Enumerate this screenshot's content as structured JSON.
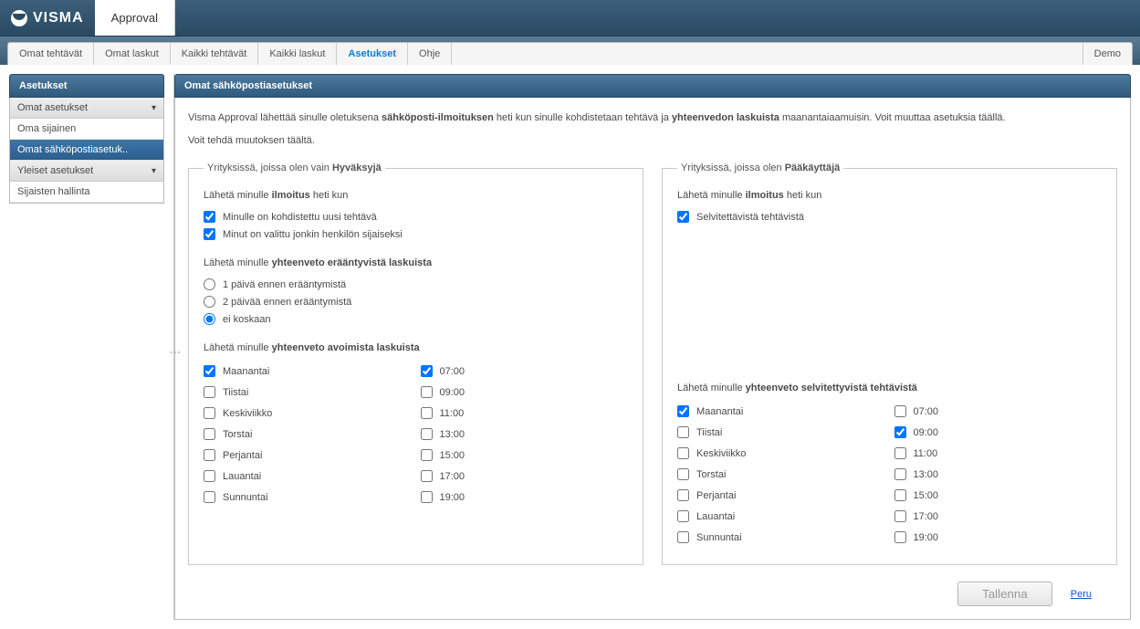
{
  "header": {
    "brand": "VISMA",
    "app_tab": "Approval"
  },
  "subnav": {
    "items": [
      "Omat tehtävät",
      "Omat laskut",
      "Kaikki tehtävät",
      "Kaikki laskut",
      "Asetukset",
      "Ohje"
    ],
    "active_index": 4,
    "right": "Demo"
  },
  "sidebar": {
    "title": "Asetukset",
    "group1": "Omat asetukset",
    "link_substitute": "Oma sijainen",
    "link_email": "Omat sähköpostiasetuk..",
    "group2": "Yleiset asetukset",
    "link_substitutes_mgmt": "Sijaisten hallinta"
  },
  "main": {
    "title": "Omat sähköpostiasetukset",
    "intro_pre": "Visma Approval lähettää sinulle oletuksena ",
    "intro_b1": "sähköposti-ilmoituksen",
    "intro_mid1": " heti kun sinulle kohdistetaan tehtävä ja ",
    "intro_b2": "yhteenvedon laskuista",
    "intro_mid2": " maanantaiaamuisin. Voit muuttaa asetuksia täällä.",
    "intro_line2": "Voit tehdä muutoksen täältä.",
    "panel_left": {
      "legend_pre": "Yrityksissä, joissa olen vain ",
      "legend_b": "Hyväksyjä",
      "notify_h_pre": "Lähetä minulle ",
      "notify_h_b": "ilmoitus",
      "notify_h_post": " heti kun",
      "cb_new_task": "Minulle on kohdistettu uusi tehtävä",
      "cb_substitute": "Minut on valittu jonkin henkilön sijaiseksi",
      "due_h_pre": "Lähetä minulle ",
      "due_h_b": "yhteenveto erääntyvistä laskuista",
      "r1": "1 päivä ennen erääntymistä",
      "r2": "2 päivää ennen erääntymistä",
      "r3": "ei koskaan",
      "open_h_pre": "Lähetä minulle ",
      "open_h_b": "yhteenveto avoimista laskuista"
    },
    "panel_right": {
      "legend_pre": "Yrityksissä, joissa olen ",
      "legend_b": "Pääkäyttäjä",
      "notify_h_pre": "Lähetä minulle ",
      "notify_h_b": "ilmoitus",
      "notify_h_post": " heti kun",
      "cb_review": "Selvitettävistä tehtävistä",
      "review_h_pre": "Lähetä minulle ",
      "review_h_b": "yhteenveto selvitettyvistä tehtävistä"
    },
    "days": [
      "Maanantai",
      "Tiistai",
      "Keskiviikko",
      "Torstai",
      "Perjantai",
      "Lauantai",
      "Sunnuntai"
    ],
    "times": [
      "07:00",
      "09:00",
      "11:00",
      "13:00",
      "15:00",
      "17:00",
      "19:00"
    ],
    "left_days_checked": [
      true,
      false,
      false,
      false,
      false,
      false,
      false
    ],
    "left_times_checked": [
      true,
      false,
      false,
      false,
      false,
      false,
      false
    ],
    "right_days_checked": [
      true,
      false,
      false,
      false,
      false,
      false,
      false
    ],
    "right_times_checked": [
      false,
      true,
      false,
      false,
      false,
      false,
      false
    ],
    "save_label": "Tallenna",
    "cancel_label": "Peru"
  }
}
